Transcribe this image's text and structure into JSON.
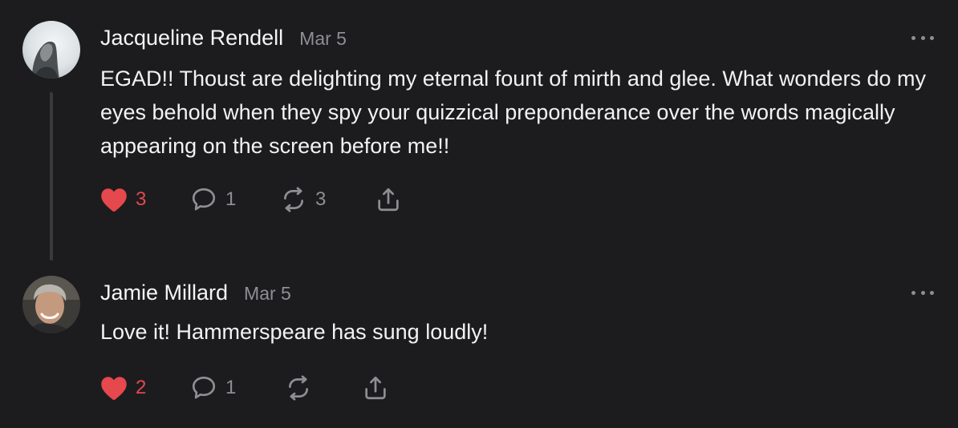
{
  "comments": [
    {
      "author": "Jacqueline Rendell",
      "date": "Mar 5",
      "text": "EGAD!! Thoust are delighting my eternal fount of mirth and glee. What wonders do my eyes behold when they spy your quizzical preponderance over the words magically appearing on the screen before me!!",
      "likes": "3",
      "replies": "1",
      "restacks": "3",
      "liked": true
    },
    {
      "author": "Jamie Millard",
      "date": "Mar 5",
      "text": "Love it! Hammerspeare has sung loudly!",
      "likes": "2",
      "replies": "1",
      "restacks": "",
      "liked": true
    }
  ],
  "icons": {
    "like": "heart-icon",
    "reply": "speech-bubble-icon",
    "restack": "restack-arrows-icon",
    "share": "share-icon",
    "more": "more-dots-icon"
  },
  "colors": {
    "background": "#1c1c1e",
    "text": "#f2f2f4",
    "muted": "#8e8e93",
    "like": "#e5484d",
    "thread_line": "#3a3a3d"
  }
}
